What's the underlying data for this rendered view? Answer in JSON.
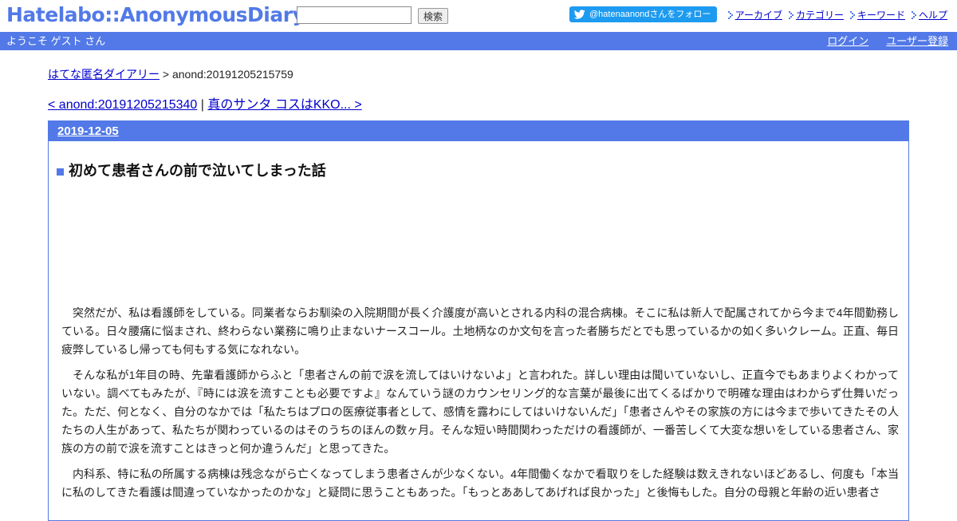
{
  "header": {
    "logo": "Hatelabo::AnonymousDiary",
    "search_placeholder": "",
    "search_button": "検索",
    "follow_button": "@hatenaanondさんをフォロー",
    "links": [
      "アーカイブ",
      "カテゴリー",
      "キーワード",
      "ヘルプ"
    ]
  },
  "welcome": {
    "text": "ようこそ ゲスト さん",
    "login": "ログイン",
    "register": "ユーザー登録"
  },
  "breadcrumb": {
    "home": "はてな匿名ダイアリー",
    "separator": ">",
    "current": "anond:20191205215759"
  },
  "pager": {
    "prev": "< anond:20191205215340",
    "separator": "|",
    "next": "真のサンタ コスはKKO... >"
  },
  "entry": {
    "date": "2019-12-05",
    "title": "初めて患者さんの前で泣いてしまった話",
    "paragraphs": [
      "突然だが、私は看護師をしている。同業者ならお馴染の入院期間が長く介護度が高いとされる内科の混合病棟。そこに私は新人で配属されてから今まで4年間勤務している。日々腰痛に悩まされ、終わらない業務に鳴り止まないナースコール。土地柄なのか文句を言った者勝ちだとでも思っているかの如く多いクレーム。正直、毎日疲弊しているし帰っても何もする気になれない。",
      "そんな私が1年目の時、先輩看護師からふと「患者さんの前で涙を流してはいけないよ」と言われた。詳しい理由は聞いていないし、正直今でもあまりよくわかっていない。調べてもみたが、『時には涙を流すことも必要ですよ』なんていう謎のカウンセリング的な言葉が最後に出てくるばかりで明確な理由はわからず仕舞いだった。ただ、何となく、自分のなかでは「私たちはプロの医療従事者として、感情を露わにしてはいけないんだ」「患者さんやその家族の方には今まで歩いてきたその人たちの人生があって、私たちが関わっているのはそのうちのほんの数ヶ月。そんな短い時間関わっただけの看護師が、一番苦しくて大変な想いをしている患者さん、家族の方の前で涙を流すことはきっと何か違うんだ」と思ってきた。",
      "内科系、特に私の所属する病棟は残念ながら亡くなってしまう患者さんが少なくない。4年間働くなかで看取りをした経験は数えきれないほどあるし、何度も「本当に私のしてきた看護は間違っていなかったのかな」と疑問に思うこともあった。「もっとああしてあげれば良かった」と後悔もした。自分の母親と年齢の近い患者さ"
    ]
  }
}
